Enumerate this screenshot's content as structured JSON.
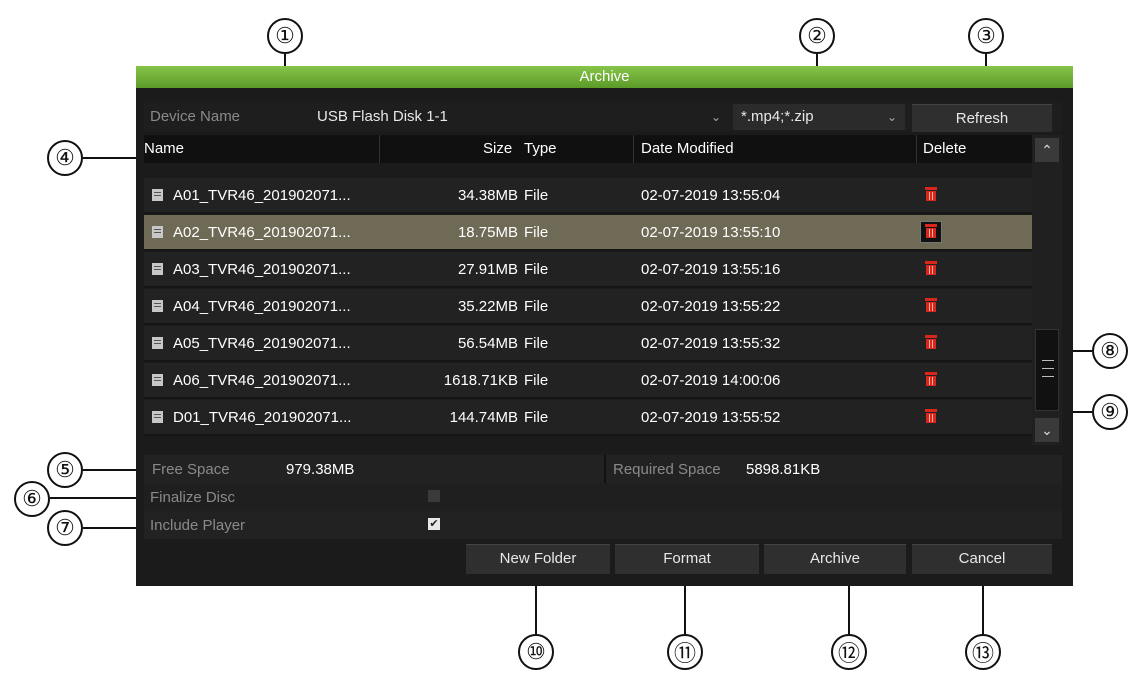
{
  "window": {
    "title": "Archive"
  },
  "device": {
    "label": "Device Name",
    "value": "USB Flash Disk 1-1",
    "filter": "*.mp4;*.zip"
  },
  "buttons": {
    "refresh": "Refresh",
    "new_folder": "New Folder",
    "format": "Format",
    "archive": "Archive",
    "cancel": "Cancel"
  },
  "table": {
    "headers": {
      "name": "Name",
      "size": "Size",
      "type": "Type",
      "date": "Date Modified",
      "delete": "Delete"
    },
    "rows": [
      {
        "name": "A01_TVR46_201902071...",
        "size": "34.38MB",
        "type": "File",
        "date": "02-07-2019 13:55:04"
      },
      {
        "name": "A02_TVR46_201902071...",
        "size": "18.75MB",
        "type": "File",
        "date": "02-07-2019 13:55:10"
      },
      {
        "name": "A03_TVR46_201902071...",
        "size": "27.91MB",
        "type": "File",
        "date": "02-07-2019 13:55:16"
      },
      {
        "name": "A04_TVR46_201902071...",
        "size": "35.22MB",
        "type": "File",
        "date": "02-07-2019 13:55:22"
      },
      {
        "name": "A05_TVR46_201902071...",
        "size": "56.54MB",
        "type": "File",
        "date": "02-07-2019 13:55:32"
      },
      {
        "name": "A06_TVR46_201902071...",
        "size": "1618.71KB",
        "type": "File",
        "date": "02-07-2019 14:00:06"
      },
      {
        "name": "D01_TVR46_201902071...",
        "size": "144.74MB",
        "type": "File",
        "date": "02-07-2019 13:55:52"
      }
    ]
  },
  "space": {
    "free_label": "Free Space",
    "free_value": "979.38MB",
    "required_label": "Required Space",
    "required_value": "5898.81KB"
  },
  "options": {
    "finalize_label": "Finalize Disc",
    "include_label": "Include Player"
  },
  "callouts": [
    "①",
    "②",
    "③",
    "④",
    "⑤",
    "⑥",
    "⑦",
    "⑧",
    "⑨",
    "⑩",
    "⑪",
    "⑫",
    "⑬"
  ],
  "colors": {
    "title_bar": "#6fb03a",
    "selected_row": "#6f6a55",
    "delete_icon": "#d9271e"
  }
}
